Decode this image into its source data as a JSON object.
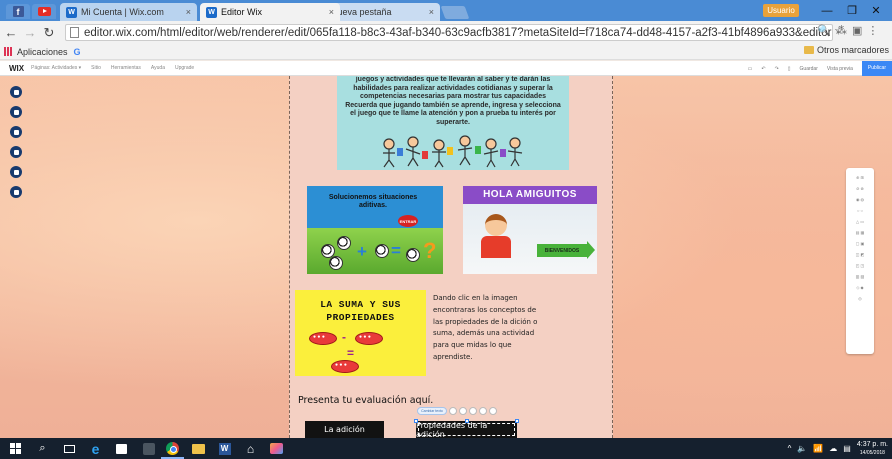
{
  "browser": {
    "tabs": [
      {
        "label": "Mi Cuenta | Wix.com",
        "close": "×"
      },
      {
        "label": "Editor Wix",
        "close": "×"
      },
      {
        "label": "Nueva pestaña",
        "close": "×"
      }
    ],
    "window_controls": {
      "minimize": "—",
      "maximize": "❐",
      "close": "✕"
    },
    "profile_label": "Usuario",
    "url": "editor.wix.com/html/editor/web/renderer/edit/065fa118-b8c3-43af-b340-63c9acfb3817?metaSiteId=f718ca74-dd48-4157-a2f3-41bf4896a933&editorSes",
    "bookmarks": {
      "apps_label": "Aplicaciones",
      "other_label": "Otros marcadores"
    }
  },
  "wix_editor": {
    "logo": "WIX",
    "menu": [
      "Páginas: Actividades ▾",
      "Sitio",
      "Herramientas",
      "Ayuda",
      "Upgrade"
    ],
    "right_actions": [
      "Guardar",
      "Vista previa",
      "Publicar"
    ]
  },
  "page": {
    "banner_text": "juegos y actividades que te llevarán al saber y te darán las habilidades para realizar actividades cotidianas y superar la competencias necesarias para mostrar tus capacidades Recuerda que jugando también se aprende, ingresa y selecciona el juego que te llame la atención y pon a prueba tu interés por superarte.",
    "card_sum_title": "Solucionemos situaciones aditivas.",
    "entrar_label": "ENTRAR",
    "card_hola_title": "HOLA AMIGUITOS",
    "bienvenidos_label": "BIENVENIDOS",
    "suma_title_line1": "LA SUMA Y SUS",
    "suma_title_line2": "PROPIEDADES",
    "suma_description": "Dando clic en la imagen encontraras los conceptos de las propiedades de la dición o suma, además una actividad para que midas lo que aprendiste.",
    "evaluation_text": "Presenta tu evaluación aquí.",
    "mini_toolbar_label": "Cambiar texto",
    "button_adicion": "La adición",
    "button_propiedades": "Propiedades de la adición"
  },
  "taskbar": {
    "time": "4:37 p. m.",
    "date": "14/05/2018"
  }
}
